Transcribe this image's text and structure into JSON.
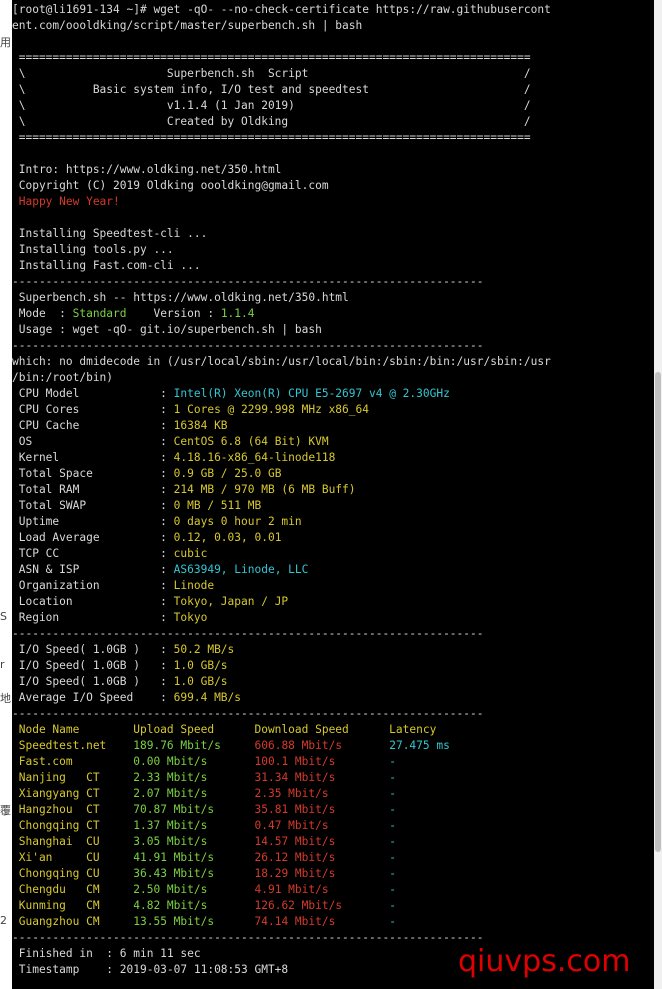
{
  "terminal": {
    "lines": [
      [
        {
          "t": "[root@li1691-134 ~]# wget -qO- --no-check-certificate https://raw.githubusercont",
          "c": "w"
        }
      ],
      [
        {
          "t": "ent.com/oooldking/script/master/superbench.sh | bash",
          "c": "w"
        }
      ],
      [],
      [
        {
          "t": " ============================================================================",
          "c": "w"
        }
      ],
      [
        {
          "t": " \\                     Superbench.sh  Script                                /",
          "c": "w"
        }
      ],
      [
        {
          "t": " \\          Basic system info, I/O test and speedtest                       /",
          "c": "w"
        }
      ],
      [
        {
          "t": " \\                     v1.1.4 (1 Jan 2019)                                  /",
          "c": "w"
        }
      ],
      [
        {
          "t": " \\                     Created by Oldking                                   /",
          "c": "w"
        }
      ],
      [
        {
          "t": " ============================================================================",
          "c": "w"
        }
      ],
      [],
      [
        {
          "t": " Intro: https://www.oldking.net/350.html",
          "c": "w"
        }
      ],
      [
        {
          "t": " Copyright (C) 2019 Oldking oooldking@gmail.com",
          "c": "w"
        }
      ],
      [
        {
          "t": " Happy New Year!",
          "c": "r"
        }
      ],
      [],
      [
        {
          "t": " Installing Speedtest-cli ...",
          "c": "w"
        }
      ],
      [
        {
          "t": " Installing tools.py ...",
          "c": "w"
        }
      ],
      [
        {
          "t": " Installing Fast.com-cli ...",
          "c": "w"
        }
      ],
      [
        {
          "t": "----------------------------------------------------------------------",
          "c": "w"
        }
      ],
      [
        {
          "t": " Superbench.sh -- https://www.oldking.net/350.html",
          "c": "w"
        }
      ],
      [
        {
          "t": " Mode  : ",
          "c": "w"
        },
        {
          "t": "Standard",
          "c": "g"
        },
        {
          "t": "    Version : ",
          "c": "w"
        },
        {
          "t": "1.1.4",
          "c": "g"
        }
      ],
      [
        {
          "t": " Usage : wget -qO- git.io/superbench.sh | bash",
          "c": "w"
        }
      ],
      [
        {
          "t": "----------------------------------------------------------------------",
          "c": "w"
        }
      ],
      [
        {
          "t": "which: no dmidecode in (/usr/local/sbin:/usr/local/bin:/sbin:/bin:/usr/sbin:/usr",
          "c": "w"
        }
      ],
      [
        {
          "t": "/bin:/root/bin)",
          "c": "w"
        }
      ],
      [
        {
          "t": " CPU Model            : ",
          "c": "w"
        },
        {
          "t": "Intel(R) Xeon(R) CPU E5-2697 v4 @ 2.30GHz",
          "c": "c"
        }
      ],
      [
        {
          "t": " CPU Cores            : ",
          "c": "w"
        },
        {
          "t": "1 Cores @ 2299.998 MHz x86_64",
          "c": "y"
        }
      ],
      [
        {
          "t": " CPU Cache            : ",
          "c": "w"
        },
        {
          "t": "16384 KB",
          "c": "y"
        }
      ],
      [
        {
          "t": " OS                   : ",
          "c": "w"
        },
        {
          "t": "CentOS 6.8 (64 Bit) KVM",
          "c": "y"
        }
      ],
      [
        {
          "t": " Kernel               : ",
          "c": "w"
        },
        {
          "t": "4.18.16-x86_64-linode118",
          "c": "y"
        }
      ],
      [
        {
          "t": " Total Space          : ",
          "c": "w"
        },
        {
          "t": "0.9 GB / 25.0 GB",
          "c": "y"
        }
      ],
      [
        {
          "t": " Total RAM            : ",
          "c": "w"
        },
        {
          "t": "214 MB / 970 MB (6 MB Buff)",
          "c": "y"
        }
      ],
      [
        {
          "t": " Total SWAP           : ",
          "c": "w"
        },
        {
          "t": "0 MB / 511 MB",
          "c": "y"
        }
      ],
      [
        {
          "t": " Uptime               : ",
          "c": "w"
        },
        {
          "t": "0 days 0 hour 2 min",
          "c": "y"
        }
      ],
      [
        {
          "t": " Load Average         : ",
          "c": "w"
        },
        {
          "t": "0.12, 0.03, 0.01",
          "c": "y"
        }
      ],
      [
        {
          "t": " TCP CC               : ",
          "c": "w"
        },
        {
          "t": "cubic",
          "c": "y"
        }
      ],
      [
        {
          "t": " ASN & ISP            : ",
          "c": "w"
        },
        {
          "t": "AS63949, Linode, LLC",
          "c": "c"
        }
      ],
      [
        {
          "t": " Organization         : ",
          "c": "w"
        },
        {
          "t": "Linode",
          "c": "y"
        }
      ],
      [
        {
          "t": " Location             : ",
          "c": "w"
        },
        {
          "t": "Tokyo, Japan / JP",
          "c": "y"
        }
      ],
      [
        {
          "t": " Region               : ",
          "c": "w"
        },
        {
          "t": "Tokyo",
          "c": "y"
        }
      ],
      [
        {
          "t": "----------------------------------------------------------------------",
          "c": "w"
        }
      ],
      [
        {
          "t": " I/O Speed( 1.0GB )   : ",
          "c": "w"
        },
        {
          "t": "50.2 MB/s",
          "c": "y"
        }
      ],
      [
        {
          "t": " I/O Speed( 1.0GB )   : ",
          "c": "w"
        },
        {
          "t": "1.0 GB/s",
          "c": "y"
        }
      ],
      [
        {
          "t": " I/O Speed( 1.0GB )   : ",
          "c": "w"
        },
        {
          "t": "1.0 GB/s",
          "c": "y"
        }
      ],
      [
        {
          "t": " Average I/O Speed    : ",
          "c": "w"
        },
        {
          "t": "699.4 MB/s",
          "c": "y"
        }
      ],
      [
        {
          "t": "----------------------------------------------------------------------",
          "c": "w"
        }
      ],
      [
        {
          "t": " Node Name        Upload Speed      Download Speed      Latency",
          "c": "y"
        }
      ],
      [
        {
          "t": " Speedtest.net    ",
          "c": "y"
        },
        {
          "t": "189.76 Mbit/s     ",
          "c": "g"
        },
        {
          "t": "606.88 Mbit/s       ",
          "c": "r"
        },
        {
          "t": "27.475 ms",
          "c": "c"
        }
      ],
      [
        {
          "t": " Fast.com         ",
          "c": "y"
        },
        {
          "t": "0.00 Mbit/s       ",
          "c": "g"
        },
        {
          "t": "100.1 Mbit/s        ",
          "c": "r"
        },
        {
          "t": "-",
          "c": "c"
        }
      ],
      [
        {
          "t": " Nanjing   CT     ",
          "c": "y"
        },
        {
          "t": "2.33 Mbit/s       ",
          "c": "g"
        },
        {
          "t": "31.34 Mbit/s        ",
          "c": "r"
        },
        {
          "t": "-",
          "c": "c"
        }
      ],
      [
        {
          "t": " Xiangyang CT     ",
          "c": "y"
        },
        {
          "t": "2.07 Mbit/s       ",
          "c": "g"
        },
        {
          "t": "2.35 Mbit/s         ",
          "c": "r"
        },
        {
          "t": "-",
          "c": "c"
        }
      ],
      [
        {
          "t": " Hangzhou  CT     ",
          "c": "y"
        },
        {
          "t": "70.87 Mbit/s      ",
          "c": "g"
        },
        {
          "t": "35.81 Mbit/s        ",
          "c": "r"
        },
        {
          "t": "-",
          "c": "c"
        }
      ],
      [
        {
          "t": " Chongqing CT     ",
          "c": "y"
        },
        {
          "t": "1.37 Mbit/s       ",
          "c": "g"
        },
        {
          "t": "0.47 Mbit/s         ",
          "c": "r"
        },
        {
          "t": "-",
          "c": "c"
        }
      ],
      [
        {
          "t": " Shanghai  CU     ",
          "c": "y"
        },
        {
          "t": "3.05 Mbit/s       ",
          "c": "g"
        },
        {
          "t": "14.57 Mbit/s        ",
          "c": "r"
        },
        {
          "t": "-",
          "c": "c"
        }
      ],
      [
        {
          "t": " Xi'an     CU     ",
          "c": "y"
        },
        {
          "t": "41.91 Mbit/s      ",
          "c": "g"
        },
        {
          "t": "26.12 Mbit/s        ",
          "c": "r"
        },
        {
          "t": "-",
          "c": "c"
        }
      ],
      [
        {
          "t": " Chongqing CU     ",
          "c": "y"
        },
        {
          "t": "36.43 Mbit/s      ",
          "c": "g"
        },
        {
          "t": "18.29 Mbit/s        ",
          "c": "r"
        },
        {
          "t": "-",
          "c": "c"
        }
      ],
      [
        {
          "t": " Chengdu   CM     ",
          "c": "y"
        },
        {
          "t": "2.50 Mbit/s       ",
          "c": "g"
        },
        {
          "t": "4.91 Mbit/s         ",
          "c": "r"
        },
        {
          "t": "-",
          "c": "c"
        }
      ],
      [
        {
          "t": " Kunming   CM     ",
          "c": "y"
        },
        {
          "t": "4.82 Mbit/s       ",
          "c": "g"
        },
        {
          "t": "126.62 Mbit/s       ",
          "c": "r"
        },
        {
          "t": "-",
          "c": "c"
        }
      ],
      [
        {
          "t": " Guangzhou CM     ",
          "c": "y"
        },
        {
          "t": "13.55 Mbit/s      ",
          "c": "g"
        },
        {
          "t": "74.14 Mbit/s        ",
          "c": "r"
        },
        {
          "t": "-",
          "c": "c"
        }
      ],
      [
        {
          "t": "----------------------------------------------------------------------",
          "c": "w"
        }
      ],
      [
        {
          "t": " Finished in  : 6 min 11 sec",
          "c": "w"
        }
      ],
      [
        {
          "t": " Timestamp    : 2019-03-07 11:08:53 GMT+8",
          "c": "w"
        }
      ]
    ]
  },
  "side_fragments": [
    {
      "text": "用",
      "row": 2
    },
    {
      "text": "S",
      "row": 38
    },
    {
      "text": "r",
      "row": 41
    },
    {
      "text": "地",
      "row": 43
    },
    {
      "text": "覆",
      "row": 50
    },
    {
      "text": "2",
      "row": 57
    }
  ],
  "watermark": "qiuvps.com",
  "colors": {
    "background": "#000000",
    "text": "#d9d9d9",
    "green": "#7bd144",
    "yellow": "#d7c82f",
    "cyan": "#33c6d4",
    "red": "#d43a2a",
    "watermark": "#e00000"
  }
}
